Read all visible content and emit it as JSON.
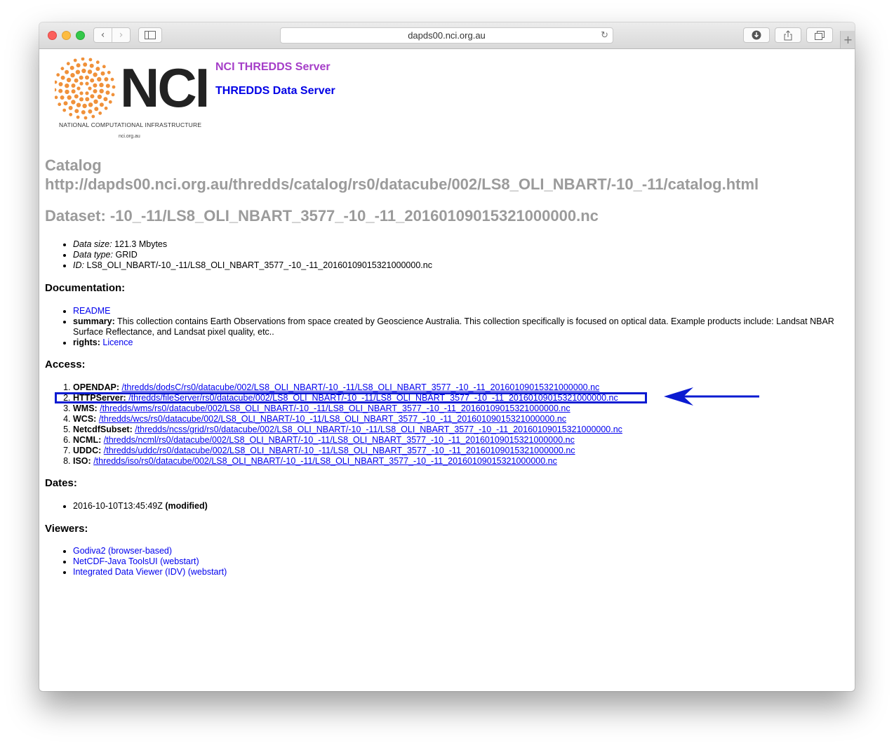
{
  "browser": {
    "url": "dapds00.nci.org.au",
    "back_glyph": "‹",
    "forward_glyph": "›",
    "reload_glyph": "↻",
    "newtab_glyph": "+"
  },
  "logo": {
    "wordmark": "NCI",
    "subtitle": "NATIONAL COMPUTATIONAL INFRASTRUCTURE",
    "url": "nci.org.au",
    "colors": {
      "dots": "#f0913a",
      "wordmark": "#222222"
    }
  },
  "header": {
    "title": "NCI THREDDS Server",
    "subtitle": "THREDDS Data Server",
    "title_color": "#a53ec8",
    "subtitle_color": "#0000e6"
  },
  "catalog": {
    "label": "Catalog",
    "url": "http://dapds00.nci.org.au/thredds/catalog/rs0/datacube/002/LS8_OLI_NBART/-10_-11/catalog.html"
  },
  "dataset": {
    "heading": "Dataset: -10_-11/LS8_OLI_NBART_3577_-10_-11_20160109015321000000.nc",
    "properties": [
      {
        "label": "Data size:",
        "value": "121.3 Mbytes"
      },
      {
        "label": "Data type:",
        "value": "GRID"
      },
      {
        "label": "ID:",
        "value": "LS8_OLI_NBART/-10_-11/LS8_OLI_NBART_3577_-10_-11_20160109015321000000.nc"
      }
    ]
  },
  "documentation": {
    "heading": "Documentation:",
    "readme": "README",
    "summary_label": "summary:",
    "summary_text": "This collection contains Earth Observations from space created by Geoscience Australia. This collection specifically is focused on optical data. Example products include: Landsat NBAR Surface Reflectance, and Landsat pixel quality, etc..",
    "rights_label": "rights:",
    "rights_link": "Licence"
  },
  "access": {
    "heading": "Access:",
    "services": [
      {
        "name": "OPENDAP:",
        "path": "/thredds/dodsC/rs0/datacube/002/LS8_OLI_NBART/-10_-11/LS8_OLI_NBART_3577_-10_-11_20160109015321000000.nc"
      },
      {
        "name": "HTTPServer:",
        "path": "/thredds/fileServer/rs0/datacube/002/LS8_OLI_NBART/-10_-11/LS8_OLI_NBART_3577_-10_-11_20160109015321000000.nc"
      },
      {
        "name": "WMS:",
        "path": "/thredds/wms/rs0/datacube/002/LS8_OLI_NBART/-10_-11/LS8_OLI_NBART_3577_-10_-11_20160109015321000000.nc"
      },
      {
        "name": "WCS:",
        "path": "/thredds/wcs/rs0/datacube/002/LS8_OLI_NBART/-10_-11/LS8_OLI_NBART_3577_-10_-11_20160109015321000000.nc"
      },
      {
        "name": "NetcdfSubset:",
        "path": "/thredds/ncss/grid/rs0/datacube/002/LS8_OLI_NBART/-10_-11/LS8_OLI_NBART_3577_-10_-11_20160109015321000000.nc"
      },
      {
        "name": "NCML:",
        "path": "/thredds/ncml/rs0/datacube/002/LS8_OLI_NBART/-10_-11/LS8_OLI_NBART_3577_-10_-11_20160109015321000000.nc"
      },
      {
        "name": "UDDC:",
        "path": "/thredds/uddc/rs0/datacube/002/LS8_OLI_NBART/-10_-11/LS8_OLI_NBART_3577_-10_-11_20160109015321000000.nc"
      },
      {
        "name": "ISO:",
        "path": "/thredds/iso/rs0/datacube/002/LS8_OLI_NBART/-10_-11/LS8_OLI_NBART_3577_-10_-11_20160109015321000000.nc"
      }
    ],
    "highlight_color": "#0b1bd1"
  },
  "dates": {
    "heading": "Dates:",
    "value": "2016-10-10T13:45:49Z",
    "type": "(modified)"
  },
  "viewers": {
    "heading": "Viewers:",
    "items": [
      "Godiva2 (browser-based)",
      "NetCDF-Java ToolsUI (webstart)",
      "Integrated Data Viewer (IDV) (webstart)"
    ]
  }
}
